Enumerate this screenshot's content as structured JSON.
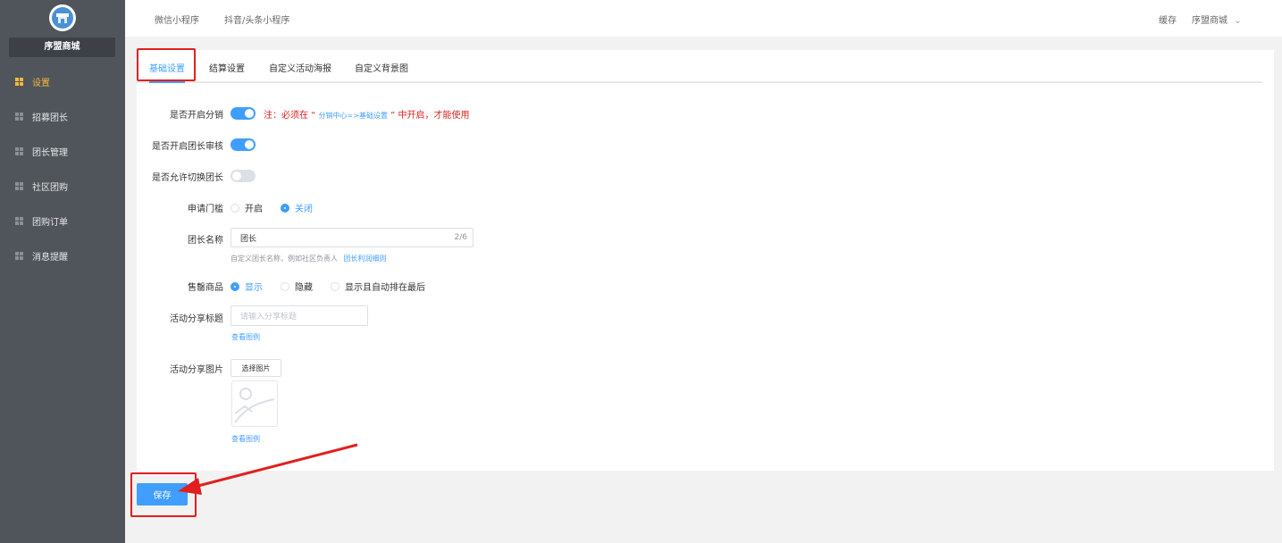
{
  "sidebar": {
    "shop_name": "序盟商城",
    "items": [
      {
        "label": "设置",
        "active": true
      },
      {
        "label": "招募团长",
        "active": false
      },
      {
        "label": "团长管理",
        "active": false
      },
      {
        "label": "社区团购",
        "active": false
      },
      {
        "label": "团购订单",
        "active": false
      },
      {
        "label": "消息提醒",
        "active": false
      }
    ]
  },
  "topbar": {
    "tabs": [
      "微信小程序",
      "抖音/头条小程序"
    ],
    "cache": "缓存",
    "user": "序盟商城",
    "chevron": "⌄"
  },
  "subtabs": [
    "基础设置",
    "结算设置",
    "自定义活动海报",
    "自定义背景图"
  ],
  "form": {
    "enable_distribution": {
      "label": "是否开启分销",
      "on": true
    },
    "note": {
      "prefix": "注：必须在 “ ",
      "link": "分销中心=>基础设置",
      "suffix": " ” 中开启，才能使用"
    },
    "enable_review": {
      "label": "是否开启团长审核",
      "on": true
    },
    "allow_switch": {
      "label": "是否允许切换团长",
      "on": false
    },
    "threshold": {
      "label": "申请门槛",
      "options": [
        "开启",
        "关闭"
      ],
      "selected": 1
    },
    "leader_name": {
      "label": "团长名称",
      "value": "团长",
      "count": "2/6",
      "help": "自定义团长名称，例如社区负责人",
      "help_link": "团长利润细则"
    },
    "soldout": {
      "label": "售罄商品",
      "options": [
        "显示",
        "隐藏",
        "显示且自动排在最后"
      ],
      "selected": 0
    },
    "share_title": {
      "label": "活动分享标题",
      "placeholder": "请输入分享标题",
      "link": "查看图例"
    },
    "share_image": {
      "label": "活动分享图片",
      "button": "选择图片",
      "link": "查看图例"
    }
  },
  "save_label": "保存",
  "colors": {
    "accent": "#409eff",
    "sidebar": "#50555c",
    "active_nav": "#f5b83d",
    "annotation": "#e02020"
  }
}
